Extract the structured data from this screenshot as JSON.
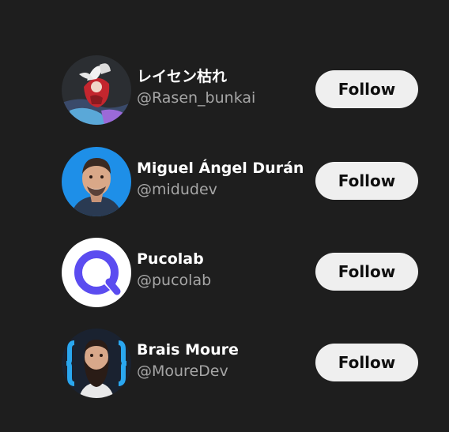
{
  "users": [
    {
      "name": "レイセン枯れ",
      "handle": "@Rasen_bunkai",
      "follow_label": "Follow"
    },
    {
      "name": "Miguel Ángel Durán",
      "handle": "@midudev",
      "follow_label": "Follow"
    },
    {
      "name": "Pucolab",
      "handle": "@pucolab",
      "follow_label": "Follow"
    },
    {
      "name": "Brais Moure",
      "handle": "@MoureDev",
      "follow_label": "Follow"
    }
  ],
  "colors": {
    "background": "#1e1e1e",
    "button_bg": "#efefef",
    "name": "#ffffff",
    "handle": "#a6a6a6",
    "pucolab_brand": "#5b4cf0",
    "midudev_bg": "#1e8fe8",
    "mouredev_accent": "#2aa7f0"
  }
}
